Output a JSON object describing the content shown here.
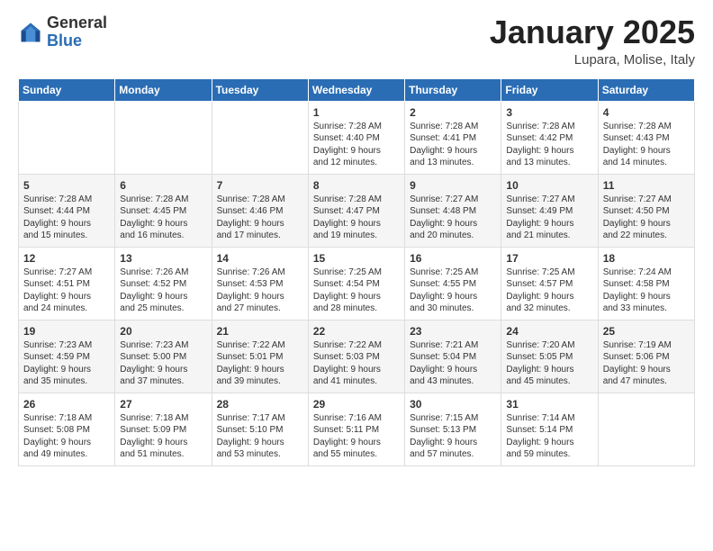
{
  "header": {
    "logo_general": "General",
    "logo_blue": "Blue",
    "title": "January 2025",
    "subtitle": "Lupara, Molise, Italy"
  },
  "days_of_week": [
    "Sunday",
    "Monday",
    "Tuesday",
    "Wednesday",
    "Thursday",
    "Friday",
    "Saturday"
  ],
  "weeks": [
    {
      "days": [
        {
          "num": "",
          "info": ""
        },
        {
          "num": "",
          "info": ""
        },
        {
          "num": "",
          "info": ""
        },
        {
          "num": "1",
          "info": "Sunrise: 7:28 AM\nSunset: 4:40 PM\nDaylight: 9 hours\nand 12 minutes."
        },
        {
          "num": "2",
          "info": "Sunrise: 7:28 AM\nSunset: 4:41 PM\nDaylight: 9 hours\nand 13 minutes."
        },
        {
          "num": "3",
          "info": "Sunrise: 7:28 AM\nSunset: 4:42 PM\nDaylight: 9 hours\nand 13 minutes."
        },
        {
          "num": "4",
          "info": "Sunrise: 7:28 AM\nSunset: 4:43 PM\nDaylight: 9 hours\nand 14 minutes."
        }
      ]
    },
    {
      "days": [
        {
          "num": "5",
          "info": "Sunrise: 7:28 AM\nSunset: 4:44 PM\nDaylight: 9 hours\nand 15 minutes."
        },
        {
          "num": "6",
          "info": "Sunrise: 7:28 AM\nSunset: 4:45 PM\nDaylight: 9 hours\nand 16 minutes."
        },
        {
          "num": "7",
          "info": "Sunrise: 7:28 AM\nSunset: 4:46 PM\nDaylight: 9 hours\nand 17 minutes."
        },
        {
          "num": "8",
          "info": "Sunrise: 7:28 AM\nSunset: 4:47 PM\nDaylight: 9 hours\nand 19 minutes."
        },
        {
          "num": "9",
          "info": "Sunrise: 7:27 AM\nSunset: 4:48 PM\nDaylight: 9 hours\nand 20 minutes."
        },
        {
          "num": "10",
          "info": "Sunrise: 7:27 AM\nSunset: 4:49 PM\nDaylight: 9 hours\nand 21 minutes."
        },
        {
          "num": "11",
          "info": "Sunrise: 7:27 AM\nSunset: 4:50 PM\nDaylight: 9 hours\nand 22 minutes."
        }
      ]
    },
    {
      "days": [
        {
          "num": "12",
          "info": "Sunrise: 7:27 AM\nSunset: 4:51 PM\nDaylight: 9 hours\nand 24 minutes."
        },
        {
          "num": "13",
          "info": "Sunrise: 7:26 AM\nSunset: 4:52 PM\nDaylight: 9 hours\nand 25 minutes."
        },
        {
          "num": "14",
          "info": "Sunrise: 7:26 AM\nSunset: 4:53 PM\nDaylight: 9 hours\nand 27 minutes."
        },
        {
          "num": "15",
          "info": "Sunrise: 7:25 AM\nSunset: 4:54 PM\nDaylight: 9 hours\nand 28 minutes."
        },
        {
          "num": "16",
          "info": "Sunrise: 7:25 AM\nSunset: 4:55 PM\nDaylight: 9 hours\nand 30 minutes."
        },
        {
          "num": "17",
          "info": "Sunrise: 7:25 AM\nSunset: 4:57 PM\nDaylight: 9 hours\nand 32 minutes."
        },
        {
          "num": "18",
          "info": "Sunrise: 7:24 AM\nSunset: 4:58 PM\nDaylight: 9 hours\nand 33 minutes."
        }
      ]
    },
    {
      "days": [
        {
          "num": "19",
          "info": "Sunrise: 7:23 AM\nSunset: 4:59 PM\nDaylight: 9 hours\nand 35 minutes."
        },
        {
          "num": "20",
          "info": "Sunrise: 7:23 AM\nSunset: 5:00 PM\nDaylight: 9 hours\nand 37 minutes."
        },
        {
          "num": "21",
          "info": "Sunrise: 7:22 AM\nSunset: 5:01 PM\nDaylight: 9 hours\nand 39 minutes."
        },
        {
          "num": "22",
          "info": "Sunrise: 7:22 AM\nSunset: 5:03 PM\nDaylight: 9 hours\nand 41 minutes."
        },
        {
          "num": "23",
          "info": "Sunrise: 7:21 AM\nSunset: 5:04 PM\nDaylight: 9 hours\nand 43 minutes."
        },
        {
          "num": "24",
          "info": "Sunrise: 7:20 AM\nSunset: 5:05 PM\nDaylight: 9 hours\nand 45 minutes."
        },
        {
          "num": "25",
          "info": "Sunrise: 7:19 AM\nSunset: 5:06 PM\nDaylight: 9 hours\nand 47 minutes."
        }
      ]
    },
    {
      "days": [
        {
          "num": "26",
          "info": "Sunrise: 7:18 AM\nSunset: 5:08 PM\nDaylight: 9 hours\nand 49 minutes."
        },
        {
          "num": "27",
          "info": "Sunrise: 7:18 AM\nSunset: 5:09 PM\nDaylight: 9 hours\nand 51 minutes."
        },
        {
          "num": "28",
          "info": "Sunrise: 7:17 AM\nSunset: 5:10 PM\nDaylight: 9 hours\nand 53 minutes."
        },
        {
          "num": "29",
          "info": "Sunrise: 7:16 AM\nSunset: 5:11 PM\nDaylight: 9 hours\nand 55 minutes."
        },
        {
          "num": "30",
          "info": "Sunrise: 7:15 AM\nSunset: 5:13 PM\nDaylight: 9 hours\nand 57 minutes."
        },
        {
          "num": "31",
          "info": "Sunrise: 7:14 AM\nSunset: 5:14 PM\nDaylight: 9 hours\nand 59 minutes."
        },
        {
          "num": "",
          "info": ""
        }
      ]
    }
  ]
}
